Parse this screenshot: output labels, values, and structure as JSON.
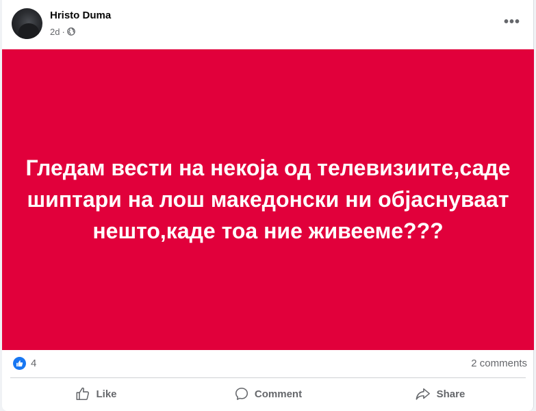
{
  "post": {
    "author": "Hristo Duma",
    "time": "2d",
    "separator": "·",
    "audience_icon": "globe-icon",
    "more_icon": "more-horizontal-icon",
    "more_label": "•••",
    "body_text": "Гледам вести на некоја од телевизиите,саде шиптари на лош македонски ни објаснуваат нешто,каде тоа ние живееме???",
    "background_color": "#e1003b",
    "text_color": "#ffffff"
  },
  "stats": {
    "reaction_icon": "like-reaction-icon",
    "reaction_count": "4",
    "comments": "2 comments"
  },
  "actions": {
    "like": "Like",
    "comment": "Comment",
    "share": "Share"
  },
  "colors": {
    "brand_blue": "#1877f2",
    "secondary_text": "#65676b"
  }
}
